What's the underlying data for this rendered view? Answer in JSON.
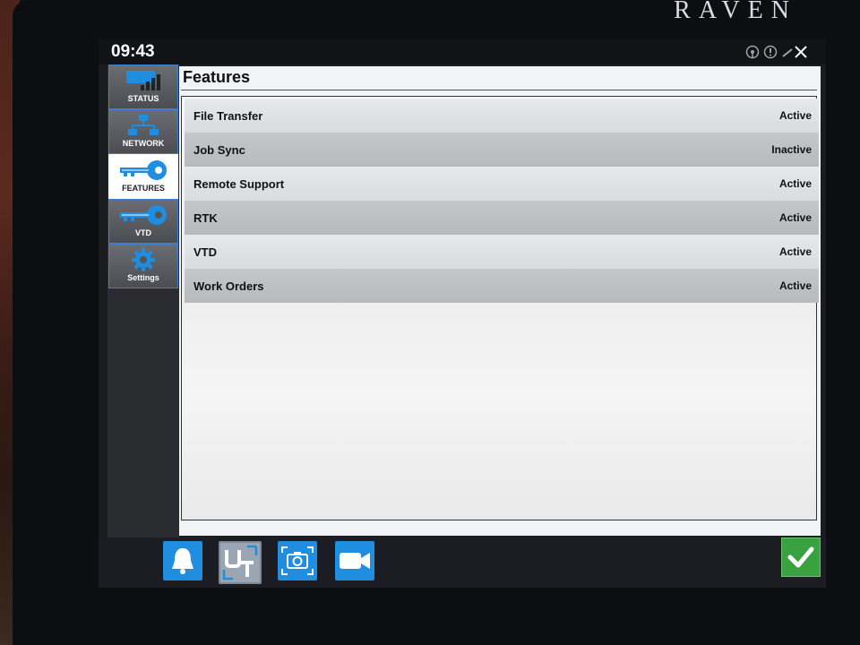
{
  "brand": "RAVEN",
  "topbar": {
    "time": "09:43",
    "icons": [
      "steering-wheel-icon",
      "warning-icon",
      "wrench-tool-icon"
    ]
  },
  "sidebar": {
    "items": [
      {
        "label": "STATUS",
        "icon": "signal-bars-icon",
        "active": false
      },
      {
        "label": "NETWORK",
        "icon": "network-icon",
        "active": false
      },
      {
        "label": "FEATURES",
        "icon": "key-icon",
        "active": true
      },
      {
        "label": "VTD",
        "icon": "key-icon",
        "active": false
      },
      {
        "label": "Settings",
        "icon": "gear-icon",
        "active": false
      }
    ]
  },
  "main": {
    "title": "Features",
    "features": [
      {
        "name": "File Transfer",
        "status": "Active"
      },
      {
        "name": "Job Sync",
        "status": "Inactive"
      },
      {
        "name": "Remote Support",
        "status": "Active"
      },
      {
        "name": "RTK",
        "status": "Active"
      },
      {
        "name": "VTD",
        "status": "Active"
      },
      {
        "name": "Work Orders",
        "status": "Active"
      }
    ]
  },
  "bottombar": {
    "buttons": [
      "bell-icon",
      "universal-terminal-icon",
      "camera-icon",
      "video-camera-icon"
    ],
    "confirm": "check-icon"
  },
  "colors": {
    "accent": "#1f8de0",
    "confirm": "#3aa140",
    "nav_border": "#3d7fd1"
  }
}
